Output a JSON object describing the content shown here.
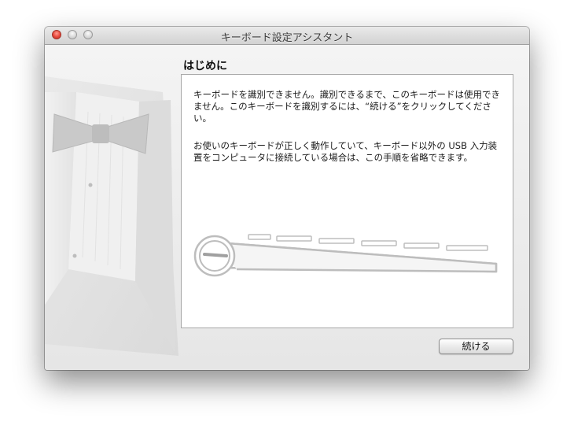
{
  "window": {
    "title": "キーボード設定アシスタント"
  },
  "main": {
    "heading": "はじめに",
    "paragraph1": "キーボードを識別できません。識別できるまで、このキーボードは使用できません。このキーボードを識別するには、“続ける”をクリックしてください。",
    "paragraph2": "お使いのキーボードが正しく動作していて、キーボード以外の USB 入力装置をコンピュータに接続している場合は、この手順を省略できます。"
  },
  "buttons": {
    "continue_label": "続ける"
  },
  "icons": {
    "close": "close-icon",
    "minimize": "minimize-icon",
    "zoom": "zoom-icon",
    "illustration": "tuxedo-illustration",
    "keyboard": "keyboard-illustration"
  },
  "colors": {
    "close_button": "#e8473b",
    "window_background": "#ececec",
    "panel_background": "#ffffff"
  }
}
